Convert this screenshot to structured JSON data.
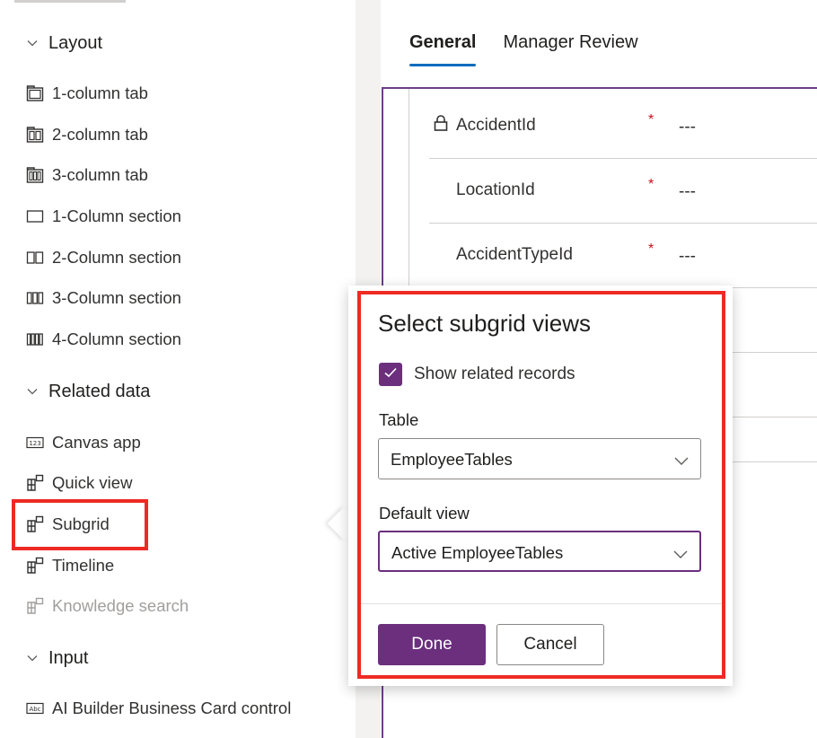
{
  "toolbox": {
    "layout_group": {
      "label": "Layout",
      "items": [
        {
          "label": "1-column tab",
          "icon": "one-column-tab-icon"
        },
        {
          "label": "2-column tab",
          "icon": "two-column-tab-icon"
        },
        {
          "label": "3-column tab",
          "icon": "three-column-tab-icon"
        },
        {
          "label": "1-Column section",
          "icon": "one-column-section-icon"
        },
        {
          "label": "2-Column section",
          "icon": "two-column-section-icon"
        },
        {
          "label": "3-Column section",
          "icon": "three-column-section-icon"
        },
        {
          "label": "4-Column section",
          "icon": "four-column-section-icon"
        }
      ]
    },
    "related_group": {
      "label": "Related data",
      "items": [
        {
          "label": "Canvas app",
          "icon": "canvas-app-icon"
        },
        {
          "label": "Quick view",
          "icon": "quick-view-icon"
        },
        {
          "label": "Subgrid",
          "icon": "subgrid-icon"
        },
        {
          "label": "Timeline",
          "icon": "timeline-icon"
        },
        {
          "label": "Knowledge search",
          "icon": "knowledge-search-icon",
          "disabled": true
        }
      ]
    },
    "input_group": {
      "label": "Input",
      "items": [
        {
          "label": "AI Builder Business Card control",
          "icon": "business-card-icon"
        }
      ]
    }
  },
  "form": {
    "tabs": [
      {
        "label": "General",
        "active": true
      },
      {
        "label": "Manager Review",
        "active": false
      }
    ],
    "fields": [
      {
        "label": "AccidentId",
        "required": "*",
        "value": "---",
        "locked": true
      },
      {
        "label": "LocationId",
        "required": "*",
        "value": "---",
        "locked": false
      },
      {
        "label": "AccidentTypeId",
        "required": "*",
        "value": "---",
        "locked": false
      }
    ]
  },
  "dialog": {
    "title": "Select subgrid views",
    "show_related_label": "Show related records",
    "show_related_checked": true,
    "table_label": "Table",
    "table_value": "EmployeeTables",
    "default_view_label": "Default view",
    "default_view_value": "Active EmployeeTables",
    "done_label": "Done",
    "cancel_label": "Cancel"
  },
  "colors": {
    "accent": "#6b2f7e",
    "highlight": "#ee2a24",
    "tab_underline": "#0f6cbd"
  }
}
